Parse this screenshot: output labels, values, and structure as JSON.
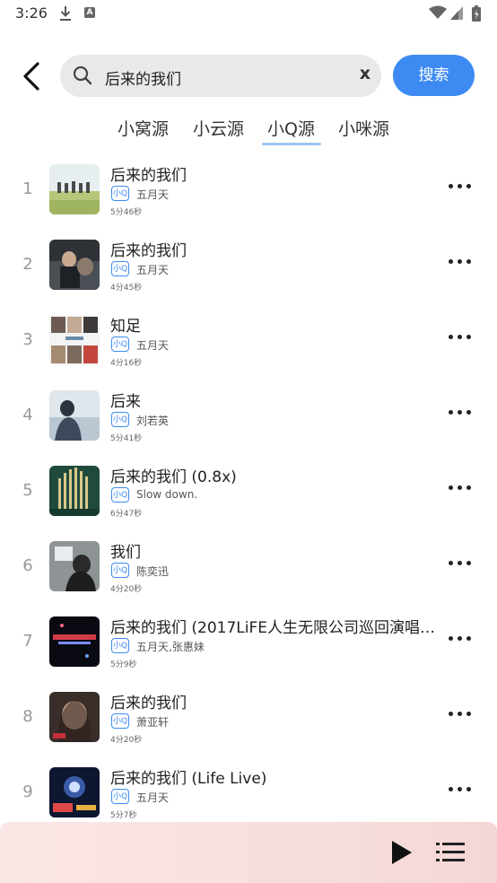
{
  "status_bar": {
    "time": "3:26",
    "download_icon": "download-icon",
    "notification_icon": "a-icon"
  },
  "search": {
    "query": "后来的我们",
    "clear_label": "x",
    "button_label": "搜索"
  },
  "tabs": [
    {
      "label": "小窝源",
      "active": false
    },
    {
      "label": "小云源",
      "active": false
    },
    {
      "label": "小Q源",
      "active": true
    },
    {
      "label": "小咪源",
      "active": false
    }
  ],
  "songs": [
    {
      "index": "1",
      "title": "后来的我们",
      "tag": "小Q",
      "artist": "五月天",
      "duration": "5分46秒"
    },
    {
      "index": "2",
      "title": "后来的我们",
      "tag": "小Q",
      "artist": "五月天",
      "duration": "4分45秒"
    },
    {
      "index": "3",
      "title": "知足",
      "tag": "小Q",
      "artist": "五月天",
      "duration": "4分16秒"
    },
    {
      "index": "4",
      "title": "后来",
      "tag": "小Q",
      "artist": "刘若英",
      "duration": "5分41秒"
    },
    {
      "index": "5",
      "title": "后来的我们 (0.8x)",
      "tag": "小Q",
      "artist": "Slow down.",
      "duration": "6分47秒"
    },
    {
      "index": "6",
      "title": "我们",
      "tag": "小Q",
      "artist": "陈奕迅",
      "duration": "4分20秒"
    },
    {
      "index": "7",
      "title": "后来的我们 (2017LiFE人生无限公司巡回演唱会…",
      "tag": "小Q",
      "artist": "五月天,张惠妹",
      "duration": "5分9秒"
    },
    {
      "index": "8",
      "title": "后来的我们",
      "tag": "小Q",
      "artist": "萧亚轩",
      "duration": "4分20秒"
    },
    {
      "index": "9",
      "title": "后来的我们 (Life Live)",
      "tag": "小Q",
      "artist": "五月天",
      "duration": "5分7秒"
    }
  ],
  "player": {
    "play_icon": "play-icon",
    "playlist_icon": "playlist-icon"
  },
  "colors": {
    "accent": "#3d8bf2",
    "tab_underline": "#9cc6ee",
    "player_bg": "#f7dede"
  }
}
